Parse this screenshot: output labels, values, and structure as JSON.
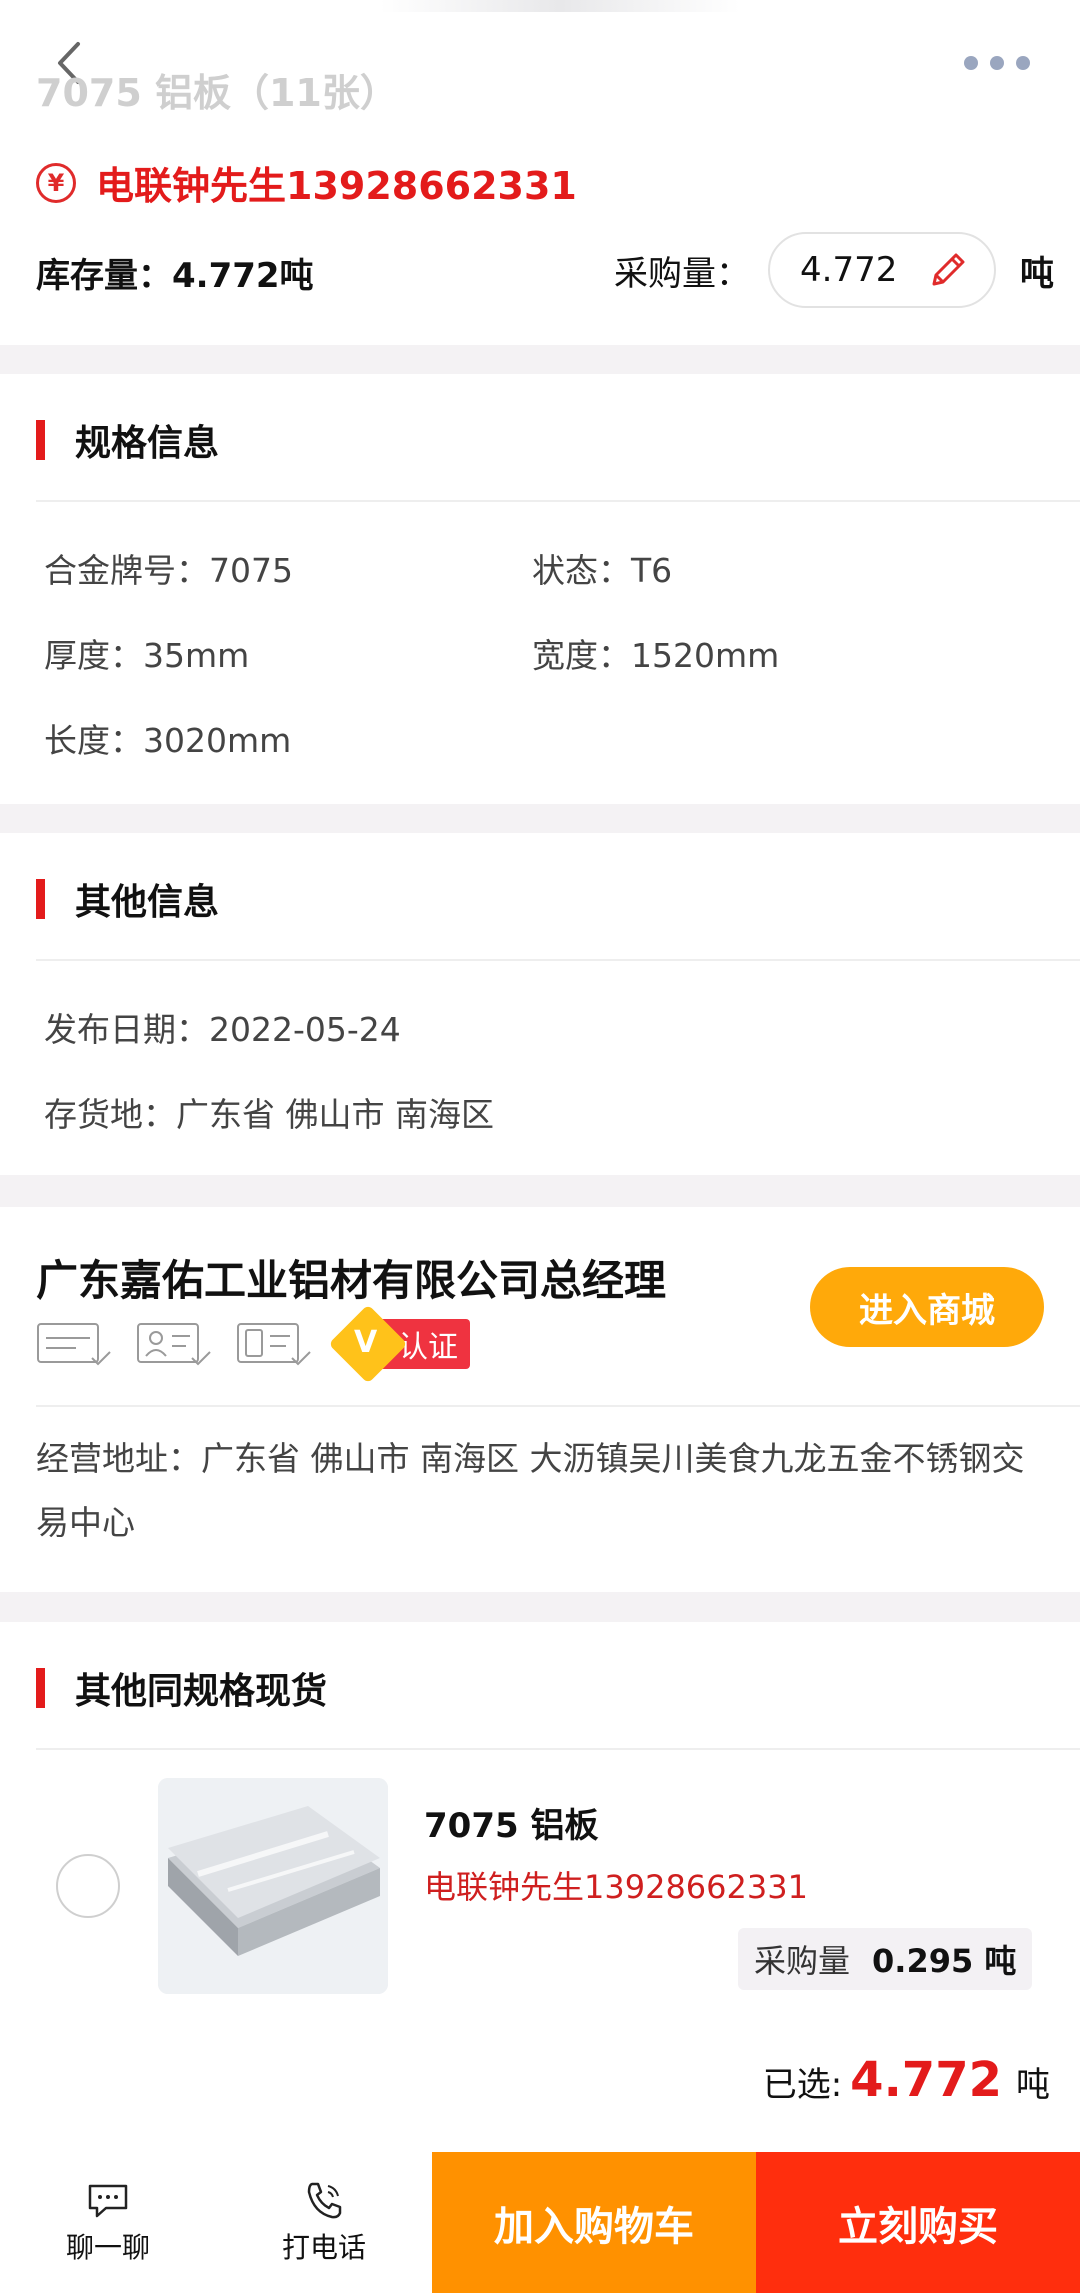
{
  "header": {
    "title": "7075 铝板（11张）"
  },
  "product": {
    "contact": "电联钟先生13928662331",
    "stock_label": "库存量：",
    "stock_value": "4.772吨",
    "buy_label": "采购量：",
    "buy_value": "4.772",
    "buy_unit": "吨"
  },
  "spec": {
    "title": "规格信息",
    "alloy": "合金牌号：7075",
    "state": "状态：T6",
    "thickness": "厚度：35mm",
    "width": "宽度：1520mm",
    "length": "长度：3020mm"
  },
  "other": {
    "title": "其他信息",
    "date": "发布日期：2022-05-24",
    "location": "存货地：广东省 佛山市 南海区"
  },
  "company": {
    "name": "广东嘉佑工业铝材有限公司总经理",
    "cert_label": "认证",
    "enter_button": "进入商城",
    "address": "经营地址：广东省 佛山市 南海区 大沥镇吴川美食九龙五金不锈钢交易中心",
    "badges": [
      "business-license-icon",
      "id-card-icon",
      "phone-verified-icon"
    ]
  },
  "same_spec": {
    "title": "其他同规格现货",
    "item": {
      "name": "7075 铝板",
      "contact": "电联钟先生13928662331",
      "qty_label": "采购量",
      "qty_value": "0.295 吨"
    },
    "selected_label": "已选:",
    "selected_value": "4.772",
    "selected_unit": "吨"
  },
  "bottom": {
    "chat": "聊一聊",
    "call": "打电话",
    "add_cart": "加入购物车",
    "buy_now": "立刻购买"
  },
  "colors": {
    "accent_red": "#e31b1b",
    "orange": "#ffa90a",
    "cart_orange": "#ff9100",
    "buy_red": "#ff2e0d"
  }
}
